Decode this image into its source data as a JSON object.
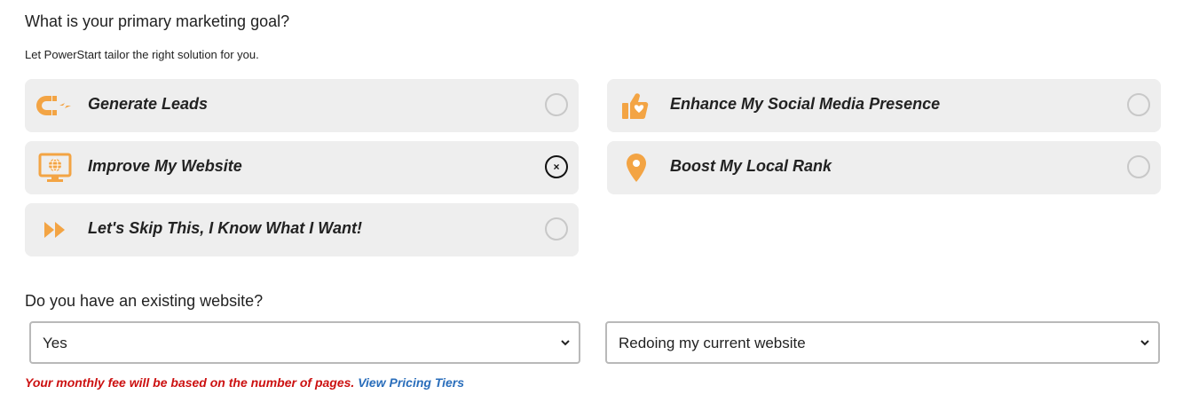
{
  "question1": {
    "title": "What is your primary marketing goal?",
    "subtitle": "Let PowerStart tailor the right solution for you."
  },
  "options": [
    {
      "label": "Generate Leads",
      "icon": "magnet-icon",
      "selected": false
    },
    {
      "label": "Enhance My Social Media Presence",
      "icon": "thumbs-up-heart-icon",
      "selected": false
    },
    {
      "label": "Improve My Website",
      "icon": "monitor-globe-icon",
      "selected": true,
      "mark": "×"
    },
    {
      "label": "Boost My Local Rank",
      "icon": "map-pin-icon",
      "selected": false
    },
    {
      "label": "Let's Skip This, I Know What I Want!",
      "icon": "fast-forward-icon",
      "selected": false
    }
  ],
  "question2": {
    "title": "Do you have an existing website?"
  },
  "selects": {
    "existing_website": "Yes",
    "website_plan": "Redoing my current website"
  },
  "note": {
    "text": "Your monthly fee will be based on the number of pages.",
    "link": "View Pricing Tiers"
  },
  "colors": {
    "accent_icon": "#f3a444",
    "option_bg": "#eeeeee",
    "note_red": "#cc1111",
    "link_blue": "#2a6ebb"
  }
}
